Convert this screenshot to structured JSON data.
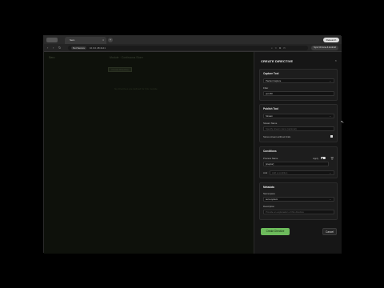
{
  "browser": {
    "tab_title": "Sero",
    "tab_close": "×",
    "new_tab": "+",
    "relaunch": "Relaunch",
    "nav_icons": [
      "‹",
      "›",
      "↻"
    ],
    "url_badge": "Not Secure",
    "url": "10.0.0.48:4141",
    "toolbar_icons": "⌕ ☆ ⧉ ▭",
    "sync_label": "Sync Chrome & Android"
  },
  "app": {
    "brand": "Sero",
    "breadcrumb": "Module · Continuous Store",
    "ghost_button": "Create Directive",
    "ghost_text": "No directives are defined for this module"
  },
  "panel": {
    "title": "CREATE DIRECTIVE",
    "close": "×",
    "capture": {
      "heading": "Capture Tool",
      "tool_value": "Packet Capture",
      "filter_label": "Filter",
      "filter_value": "port 80"
    },
    "publish": {
      "heading": "Publish Tool",
      "tool_value": "Stream",
      "stream_label": "Stream Name",
      "stream_placeholder": "Specify stream name (optional)",
      "option_label": "Stores stream without limits"
    },
    "conditions": {
      "heading": "Conditions",
      "process_label": "Process Name",
      "apply_label": "Apply",
      "process_value": "[sreptor]",
      "and_label": "And",
      "add_condition": "Add a condition"
    },
    "metadata": {
      "heading": "Metadata",
      "namespace_label": "Namespace",
      "namespace_value": "sero-system",
      "description_label": "Description",
      "description_placeholder": "Provide an explanation of this directive"
    },
    "create_button": "Create Directive",
    "cancel_button": "Cancel"
  },
  "colors": {
    "accent_green": "#6dbb5c",
    "panel_bg": "#161616",
    "overlay_bg": "#0e110b"
  }
}
